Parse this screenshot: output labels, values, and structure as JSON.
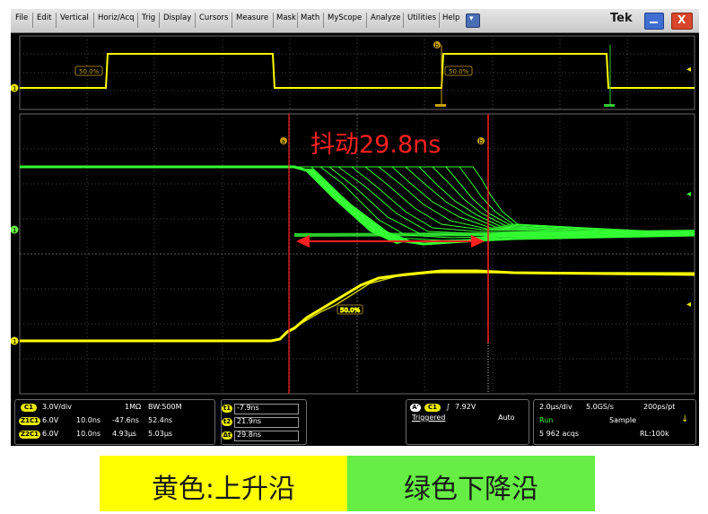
{
  "menu": {
    "items": [
      "File",
      "Edit",
      "Vertical",
      "Horiz/Acq",
      "Trig",
      "Display",
      "Cursors",
      "Measure",
      "Mask",
      "Math",
      "MyScope",
      "Analyze",
      "Utilities",
      "Help"
    ],
    "brand": "Tek",
    "dropdown_glyph": "▾",
    "close_glyph": "X"
  },
  "annotation": {
    "jitter_label": "抖动29.8ns",
    "cursor_a": "a",
    "cursor_b": "b"
  },
  "ref_labels": {
    "top_level": "50.0%",
    "top_level_2": "50.0%",
    "bottom_level": "50.0%",
    "ch1": "1",
    "ch1_mid": "1",
    "ch1_bottom": "1",
    "marker_b": "b"
  },
  "readout": {
    "ch1": {
      "badge": "C1",
      "scale": "3.0V/div",
      "coupling": "1MΩ",
      "bw": "BW:500M"
    },
    "z1": {
      "badge": "Z1C1",
      "scale": "6.0V",
      "pos": "10.0ns",
      "t1": "-47.6ns",
      "t2": "52.4ns"
    },
    "z2": {
      "badge": "Z2C1",
      "scale": "6.0V",
      "pos": "10.0ns",
      "t1": "4.93μs",
      "t2": "5.03μs"
    },
    "cursors": [
      {
        "badge": "t1",
        "value": "-7.9ns"
      },
      {
        "badge": "t2",
        "value": "21.9ns"
      },
      {
        "badge": "Δt",
        "value": "29.8ns"
      }
    ],
    "trigger": {
      "mode_badge": "A'",
      "source": "C1",
      "slope": "∫",
      "level": "7.92V",
      "status": "Triggered",
      "sweep": "Auto"
    },
    "horizontal": {
      "scale": "2.0μs/div",
      "rate": "5.0GS/s",
      "points": "200ps/pt",
      "state": "Run",
      "acq_mode": "Sample",
      "acqs": "5 962 acqs",
      "record": "RL:100k"
    }
  },
  "legend": {
    "yellow_label": "黄色:上升沿",
    "green_label": "绿色下降沿"
  },
  "colors": {
    "yellow": "#ffff00",
    "green": "#33ff33",
    "red": "#ff2020",
    "screen": "#000000"
  }
}
